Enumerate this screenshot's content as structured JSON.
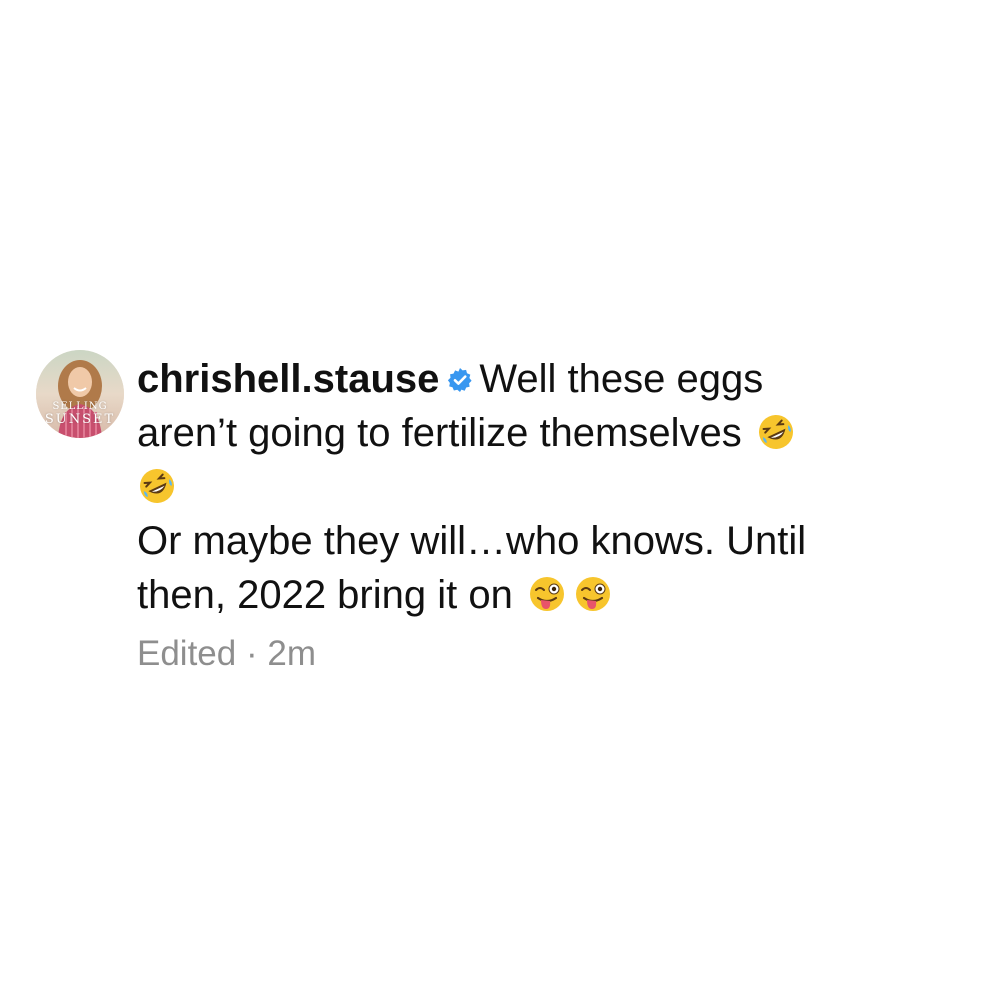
{
  "comment": {
    "avatar": {
      "text_line1": "SELLING",
      "text_line2": "SUNSET"
    },
    "username": "chrishell.stause",
    "verified_icon": "verified-badge-icon",
    "line1_text": "Well these eggs",
    "line2_text": "aren’t going to fertilize themselves",
    "line4_text": "Or maybe they will…who knows. Until",
    "line5_text": "then, 2022 bring it on",
    "emoji_laugh": "rolling-on-floor-laughing-emoji",
    "emoji_wink": "winking-face-with-tongue-emoji",
    "edited_label": "Edited",
    "separator": "·",
    "timestamp": "2m"
  },
  "colors": {
    "background": "#ffffff",
    "text": "#111111",
    "meta": "#8e8e8e",
    "verified": "#3897f0"
  }
}
